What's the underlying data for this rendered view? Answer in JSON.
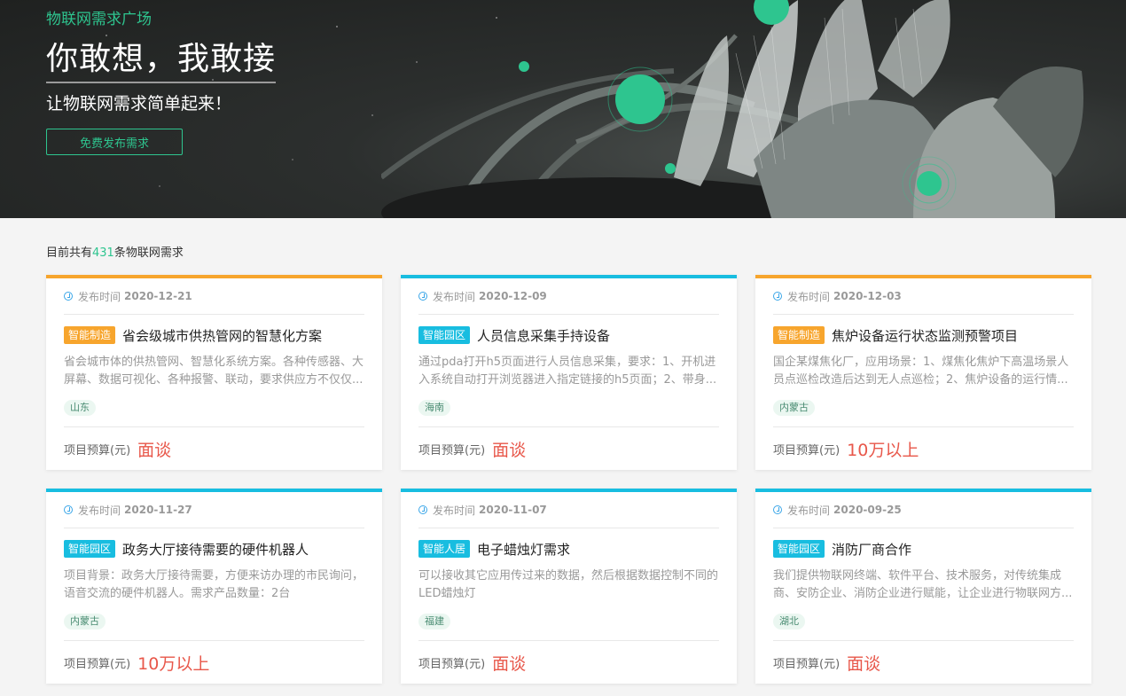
{
  "hero": {
    "tag": "物联网需求广场",
    "title": "你敢想，我敢接",
    "subtitle": "让物联网需求简单起来！",
    "button": "免费发布需求"
  },
  "summary": {
    "prefix": "目前共有",
    "count": "431",
    "suffix": "条物联网需求"
  },
  "labels": {
    "publish_time": "发布时间",
    "budget": "项目预算(元)"
  },
  "colors": {
    "accent": "#2ec58f",
    "orange": "#f7a52d",
    "blue": "#18bde0",
    "budget": "#e8574a"
  },
  "cards": [
    {
      "color": "orange",
      "date": "2020-12-21",
      "category": "智能制造",
      "title": "省会级城市供热管网的智慧化方案",
      "desc": "省会城市体的供热管网、智慧化系统方案。各种传感器、大屏幕、数据可视化、各种报警、联动，要求供应方不仅仅...",
      "region": "山东",
      "budget": "面谈"
    },
    {
      "color": "blue",
      "date": "2020-12-09",
      "category": "智能园区",
      "title": "人员信息采集手持设备",
      "desc": "通过pda打开h5页面进行人员信息采集，要求：1、开机进入系统自动打开浏览器进入指定链接的h5页面；2、带身...",
      "region": "海南",
      "budget": "面谈"
    },
    {
      "color": "orange",
      "date": "2020-12-03",
      "category": "智能制造",
      "title": "焦炉设备运行状态监测预警项目",
      "desc": "国企某煤焦化厂，应用场景：1、煤焦化焦炉下高温场景人员点巡检改造后达到无人点巡检；2、焦炉设备的运行情...",
      "region": "内蒙古",
      "budget": "10万以上"
    },
    {
      "color": "blue",
      "date": "2020-11-27",
      "category": "智能园区",
      "title": "政务大厅接待需要的硬件机器人",
      "desc": "项目背景：政务大厅接待需要，方便来访办理的市民询问，语音交流的硬件机器人。需求产品数量：2台",
      "region": "内蒙古",
      "budget": "10万以上"
    },
    {
      "color": "blue",
      "date": "2020-11-07",
      "category": "智能人居",
      "title": "电子蜡烛灯需求",
      "desc": "可以接收其它应用传过来的数据，然后根据数据控制不同的LED蜡烛灯",
      "region": "福建",
      "budget": "面谈"
    },
    {
      "color": "blue",
      "date": "2020-09-25",
      "category": "智能园区",
      "title": "消防厂商合作",
      "desc": "我们提供物联网终端、软件平台、技术服务，对传统集成商、安防企业、消防企业进行赋能，让企业进行物联网方...",
      "region": "湖北",
      "budget": "面谈"
    }
  ]
}
